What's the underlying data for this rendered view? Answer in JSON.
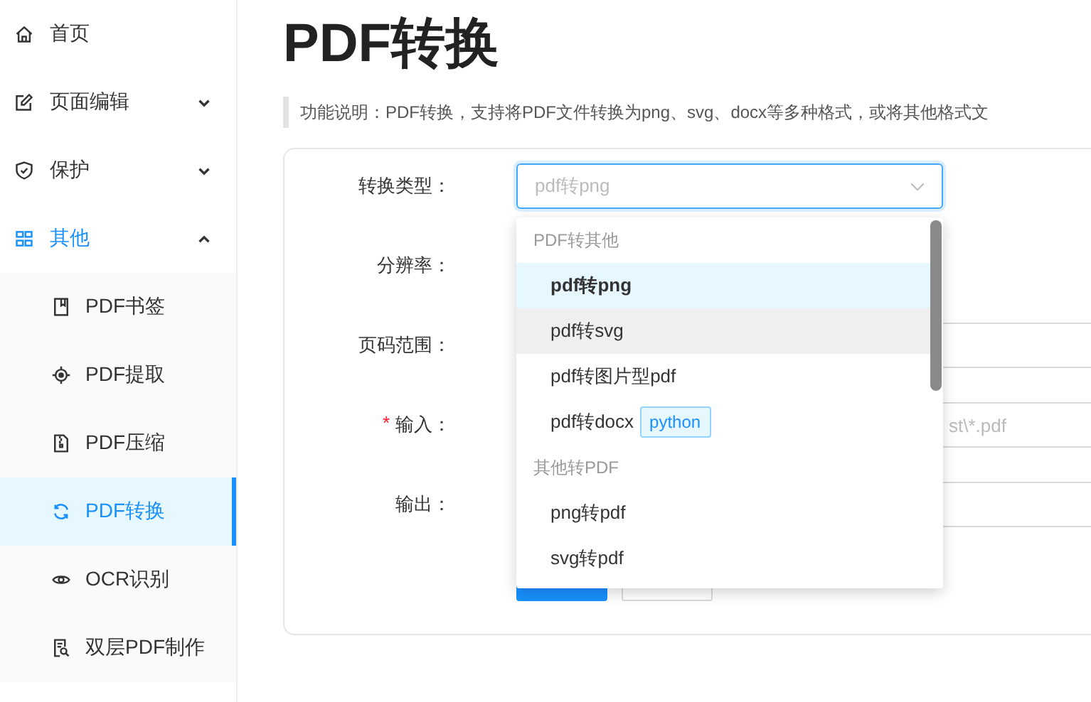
{
  "sidebar": {
    "items": [
      {
        "label": "首页",
        "kind": "link",
        "selected": false
      },
      {
        "label": "页面编辑",
        "kind": "submenu",
        "expanded": false,
        "selected": false
      },
      {
        "label": "保护",
        "kind": "submenu",
        "expanded": false,
        "selected": false
      },
      {
        "label": "其他",
        "kind": "submenu",
        "expanded": true,
        "selected": true,
        "children": [
          {
            "label": "PDF书签",
            "selected": false
          },
          {
            "label": "PDF提取",
            "selected": false
          },
          {
            "label": "PDF压缩",
            "selected": false
          },
          {
            "label": "PDF转换",
            "selected": true
          },
          {
            "label": "OCR识别",
            "selected": false
          },
          {
            "label": "双层PDF制作",
            "selected": false
          }
        ]
      }
    ]
  },
  "main": {
    "title": "PDF转换",
    "description": "功能说明：PDF转换，支持将PDF文件转换为png、svg、docx等多种格式，或将其他格式文"
  },
  "form": {
    "fields": [
      {
        "label": "转换类型：",
        "kind": "select",
        "placeholder": "pdf转png",
        "focused": true
      },
      {
        "label": "分辨率：",
        "kind": "covered"
      },
      {
        "label": "页码范围：",
        "kind": "text"
      },
      {
        "label": "输入：",
        "kind": "text",
        "placeholder": "st\\*.pdf",
        "required_mark": "*"
      },
      {
        "label": "输出：",
        "kind": "text"
      }
    ],
    "buttons": [
      {
        "kind": "primary"
      },
      {
        "kind": "default"
      }
    ]
  },
  "dropdown": {
    "groups": [
      {
        "label": "PDF转其他",
        "options": [
          {
            "label": "pdf转png",
            "selected": true,
            "hovered": false
          },
          {
            "label": "pdf转svg",
            "selected": false,
            "hovered": true
          },
          {
            "label": "pdf转图片型pdf",
            "selected": false,
            "hovered": false
          },
          {
            "label": "pdf转docx",
            "selected": false,
            "hovered": false,
            "tag": "python"
          }
        ]
      },
      {
        "label": "其他转PDF",
        "options": [
          {
            "label": "png转pdf",
            "selected": false,
            "hovered": false
          },
          {
            "label": "svg转pdf",
            "selected": false,
            "hovered": false
          }
        ]
      }
    ]
  }
}
